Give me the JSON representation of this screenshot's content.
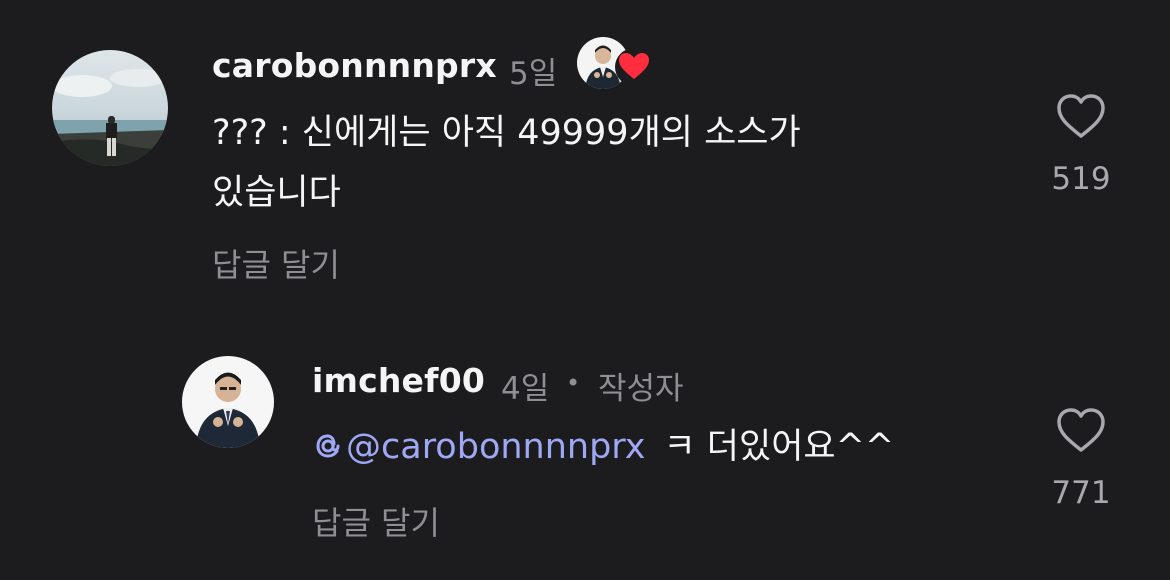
{
  "comments": [
    {
      "username": "carobonnnnprx",
      "time": "5일",
      "text_line1": "??? : 신에게는 아직 49999개의 소스가",
      "text_line2": "있습니다",
      "reply_label": "답글 달기",
      "like_count": "519",
      "creator_liked": true
    },
    {
      "username": "imchef00",
      "time": "4일",
      "separator": "•",
      "author_badge": "작성자",
      "mention": "@carobonnnnprx",
      "text": "ㅋ 더있어요^^",
      "reply_label": "답글 달기",
      "like_count": "771"
    }
  ],
  "colors": {
    "background": "#1c1c1e",
    "text_primary": "#f5f5f5",
    "text_secondary": "#8e8e93",
    "mention": "#9fa8f5",
    "heart_badge": "#ff2d3d"
  },
  "icons": [
    "heart-outline-icon",
    "heart-filled-icon",
    "threads-icon"
  ]
}
